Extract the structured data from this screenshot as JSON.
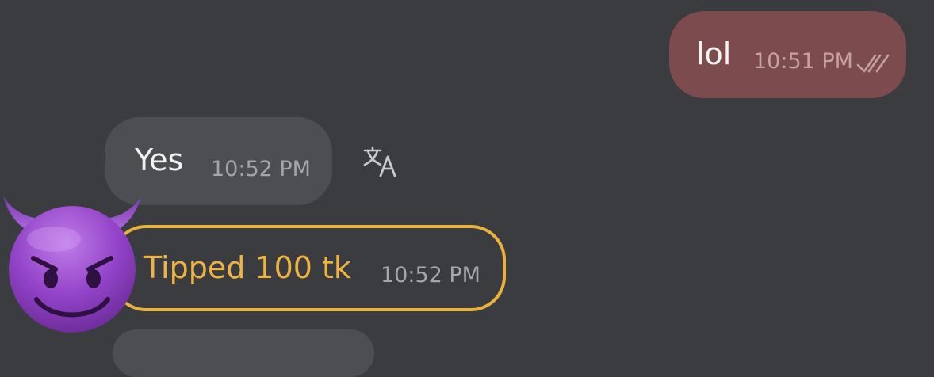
{
  "messages": [
    {
      "type": "outgoing",
      "text": "lol",
      "time": "10:51 PM",
      "status_icon": "double-check-icon"
    },
    {
      "type": "incoming",
      "text": "Yes",
      "time": "10:52 PM",
      "action_icon": "translate-icon"
    },
    {
      "type": "tip",
      "text": "Tipped 100 tk",
      "time": "10:52 PM",
      "avatar_icon": "smiling-devil-emoji-icon"
    },
    {
      "type": "incoming",
      "text": "",
      "time": ""
    }
  ],
  "colors": {
    "background": "#3b3c3f",
    "outgoing_bubble": "#7b4b4d",
    "incoming_bubble": "#4d4e51",
    "tip_accent": "#e9b23c",
    "avatar": "#8b3fbd"
  }
}
